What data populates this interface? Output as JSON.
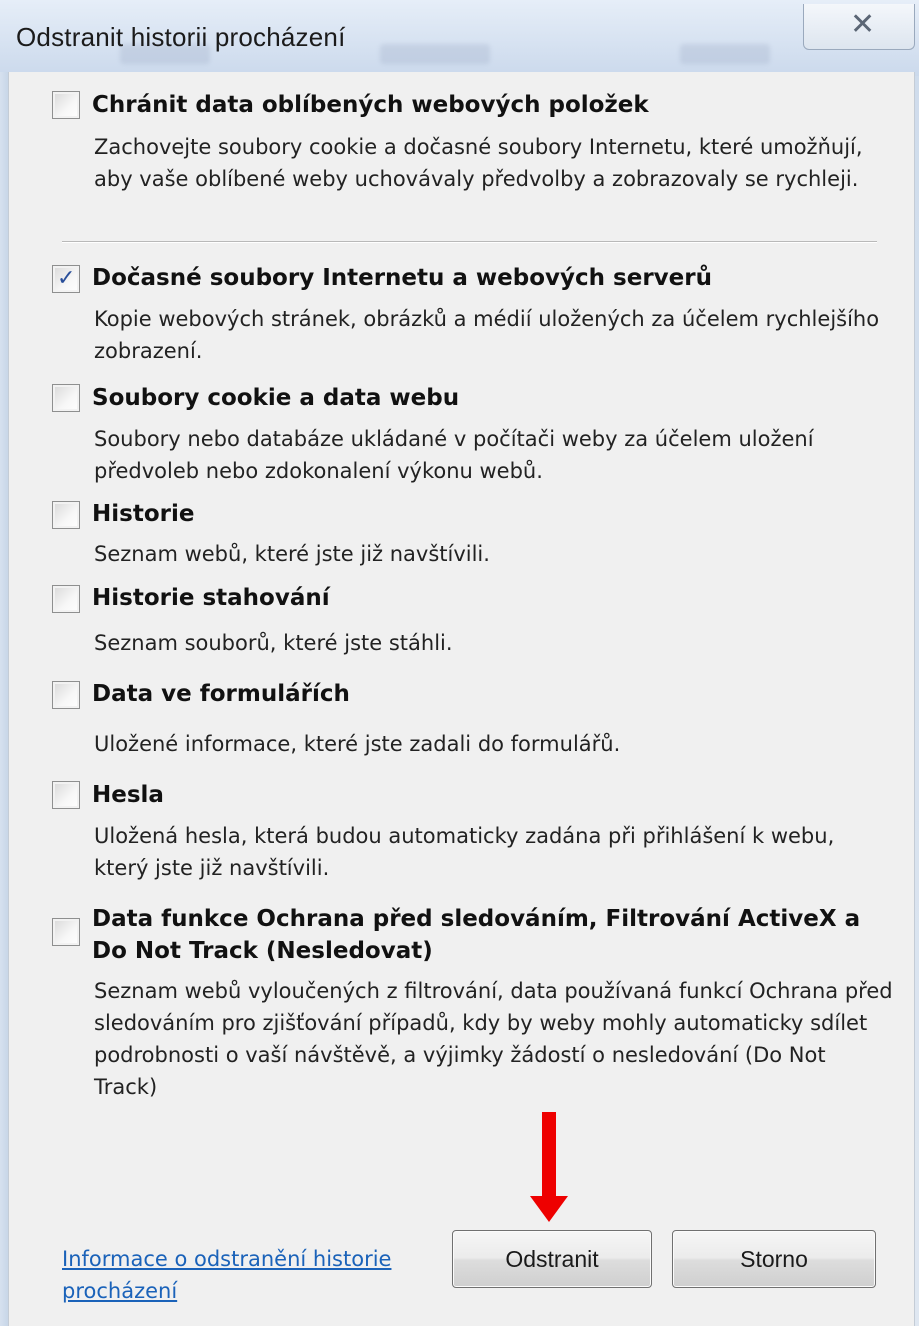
{
  "window": {
    "title": "Odstranit historii procházení"
  },
  "options": [
    {
      "checked": false,
      "title": "Chránit data oblíbených webových položek",
      "description": "Zachovejte soubory cookie a dočasné soubory Internetu, které umožňují, aby vaše oblíbené weby uchovávaly předvolby a zobrazovaly se rychleji."
    },
    {
      "checked": true,
      "title": "Dočasné soubory Internetu a webových serverů",
      "description": "Kopie webových stránek, obrázků a médií uložených za účelem rychlejšího zobrazení."
    },
    {
      "checked": false,
      "title": "Soubory cookie a data webu",
      "description": "Soubory nebo databáze ukládané v počítači weby za účelem uložení předvoleb nebo zdokonalení výkonu webů."
    },
    {
      "checked": false,
      "title": "Historie",
      "description": "Seznam webů, které jste již navštívili."
    },
    {
      "checked": false,
      "title": "Historie stahování",
      "description": "Seznam souborů, které jste stáhli."
    },
    {
      "checked": false,
      "title": "Data ve formulářích",
      "description": "Uložené informace, které jste zadali do formulářů."
    },
    {
      "checked": false,
      "title": "Hesla",
      "description": "Uložená hesla, která budou automaticky zadána při přihlášení k webu, který jste již navštívili."
    },
    {
      "checked": false,
      "title": "Data funkce Ochrana před sledováním, Filtrování ActiveX a Do Not Track (Nesledovat)",
      "description": "Seznam webů vyloučených z filtrování, data používaná funkcí Ochrana před sledováním pro zjišťování případů, kdy by weby mohly automaticky sdílet podrobnosti o vaší návštěvě, a výjimky žádostí o nesledování (Do Not Track)"
    }
  ],
  "footer": {
    "help_link": "Informace o odstranění historie procházení",
    "delete_button": "Odstranit",
    "cancel_button": "Storno"
  },
  "icons": {
    "close": "close-icon",
    "check": "check-icon",
    "annotation": "red-down-arrow"
  },
  "colors": {
    "link": "#1a62b9",
    "annotation_arrow": "#ee0000",
    "check": "#2a4f9a"
  }
}
